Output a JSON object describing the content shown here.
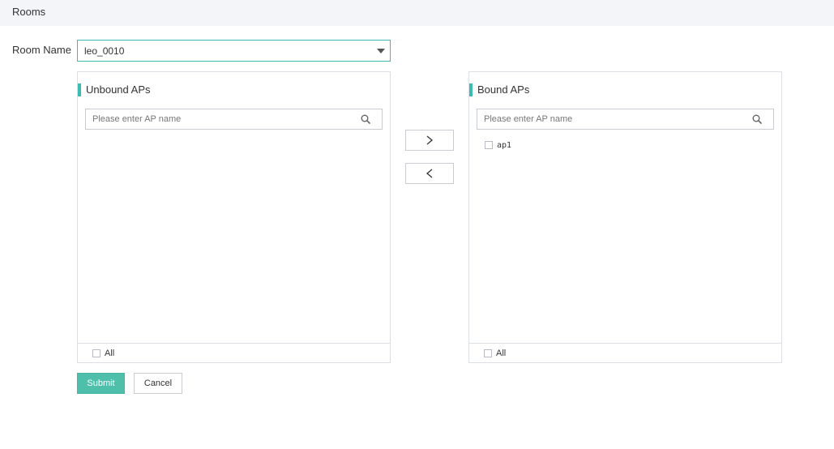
{
  "header": {
    "title": "Rooms"
  },
  "room": {
    "label": "Room Name",
    "selected": "leo_0010"
  },
  "unbound": {
    "title": "Unbound APs",
    "search_placeholder": "Please enter AP name",
    "items": [],
    "all_label": "All"
  },
  "bound": {
    "title": "Bound APs",
    "search_placeholder": "Please enter AP name",
    "items": [
      {
        "label": "ap1",
        "checked": false
      }
    ],
    "all_label": "All"
  },
  "actions": {
    "submit_label": "Submit",
    "cancel_label": "Cancel"
  },
  "colors": {
    "accent": "#3cbbb1",
    "submit_bg": "#4dbfaa",
    "header_bg": "#f3f5f8",
    "border": "#dcdfe3"
  },
  "icons": {
    "room_select": "caret-down-icon",
    "search": "search-icon",
    "move_right": "chevron-right-icon",
    "move_left": "chevron-left-icon"
  }
}
